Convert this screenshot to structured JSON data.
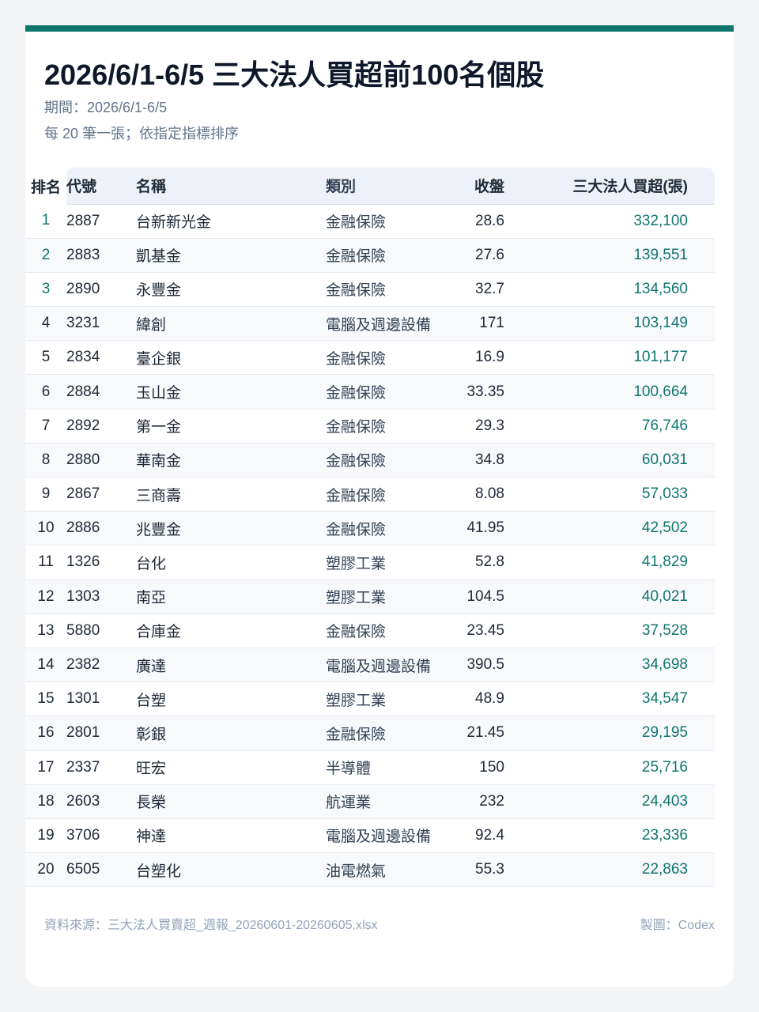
{
  "title": "2026/6/1-6/5 三大法人買超前100名個股",
  "period": "期間：2026/6/1-6/5",
  "note": "每 20 筆一張；依指定指標排序",
  "colors": {
    "accent": "#0f766e",
    "header_bg": "#eef1f7"
  },
  "table": {
    "headers": [
      "排名",
      "代號",
      "名稱",
      "類別",
      "收盤",
      "三大法人買超(張)"
    ],
    "rows": [
      [
        "1",
        "2887",
        "台新新光金",
        "金融保險",
        "28.6",
        "332,100"
      ],
      [
        "2",
        "2883",
        "凱基金",
        "金融保險",
        "27.6",
        "139,551"
      ],
      [
        "3",
        "2890",
        "永豐金",
        "金融保險",
        "32.7",
        "134,560"
      ],
      [
        "4",
        "3231",
        "緯創",
        "電腦及週邊設備",
        "171",
        "103,149"
      ],
      [
        "5",
        "2834",
        "臺企銀",
        "金融保險",
        "16.9",
        "101,177"
      ],
      [
        "6",
        "2884",
        "玉山金",
        "金融保險",
        "33.35",
        "100,664"
      ],
      [
        "7",
        "2892",
        "第一金",
        "金融保險",
        "29.3",
        "76,746"
      ],
      [
        "8",
        "2880",
        "華南金",
        "金融保險",
        "34.8",
        "60,031"
      ],
      [
        "9",
        "2867",
        "三商壽",
        "金融保險",
        "8.08",
        "57,033"
      ],
      [
        "10",
        "2886",
        "兆豐金",
        "金融保險",
        "41.95",
        "42,502"
      ],
      [
        "11",
        "1326",
        "台化",
        "塑膠工業",
        "52.8",
        "41,829"
      ],
      [
        "12",
        "1303",
        "南亞",
        "塑膠工業",
        "104.5",
        "40,021"
      ],
      [
        "13",
        "5880",
        "合庫金",
        "金融保險",
        "23.45",
        "37,528"
      ],
      [
        "14",
        "2382",
        "廣達",
        "電腦及週邊設備",
        "390.5",
        "34,698"
      ],
      [
        "15",
        "1301",
        "台塑",
        "塑膠工業",
        "48.9",
        "34,547"
      ],
      [
        "16",
        "2801",
        "彰銀",
        "金融保險",
        "21.45",
        "29,195"
      ],
      [
        "17",
        "2337",
        "旺宏",
        "半導體",
        "150",
        "25,716"
      ],
      [
        "18",
        "2603",
        "長榮",
        "航運業",
        "232",
        "24,403"
      ],
      [
        "19",
        "3706",
        "神達",
        "電腦及週邊設備",
        "92.4",
        "23,336"
      ],
      [
        "20",
        "6505",
        "台塑化",
        "油電燃氣",
        "55.3",
        "22,863"
      ]
    ]
  },
  "footer": {
    "source": "資料來源：三大法人買賣超_週報_20260601-20260605.xlsx",
    "credit": "製圖：Codex"
  }
}
